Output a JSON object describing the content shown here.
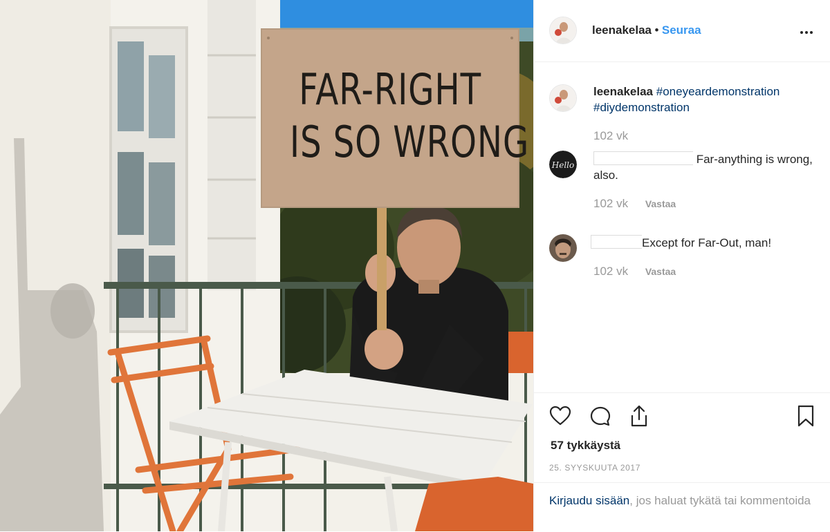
{
  "post": {
    "sign": {
      "line1": "FAR-RIGHT",
      "line2": "IS SO WRONG"
    }
  },
  "header": {
    "username": "leenakelaa",
    "separator": "•",
    "follow_label": "Seuraa"
  },
  "caption": {
    "username": "leenakelaa",
    "hashtag1": "#oneyeardemonstration",
    "hashtag2": "#diydemonstration",
    "age": "102 vk"
  },
  "comments": [
    {
      "text": " Far-anything is wrong, also.",
      "age": "102 vk",
      "reply_label": "Vastaa",
      "avatar_text": "Hello"
    },
    {
      "text": "Except for Far-Out, man!",
      "age": "102 vk",
      "reply_label": "Vastaa"
    }
  ],
  "footer": {
    "likes": "57 tykkäystä",
    "date": "25. SYYSKUUTA 2017",
    "login_link": "Kirjaudu sisään",
    "login_rest": ", jos haluat tykätä tai kommentoida"
  },
  "colors": {
    "link_blue": "#3897f0",
    "hashtag_navy": "#003569",
    "muted_gray": "#999999",
    "sign_cardboard": "#c4a58a"
  },
  "icons": [
    "more-icon",
    "heart-icon",
    "comment-icon",
    "share-icon",
    "bookmark-icon"
  ]
}
